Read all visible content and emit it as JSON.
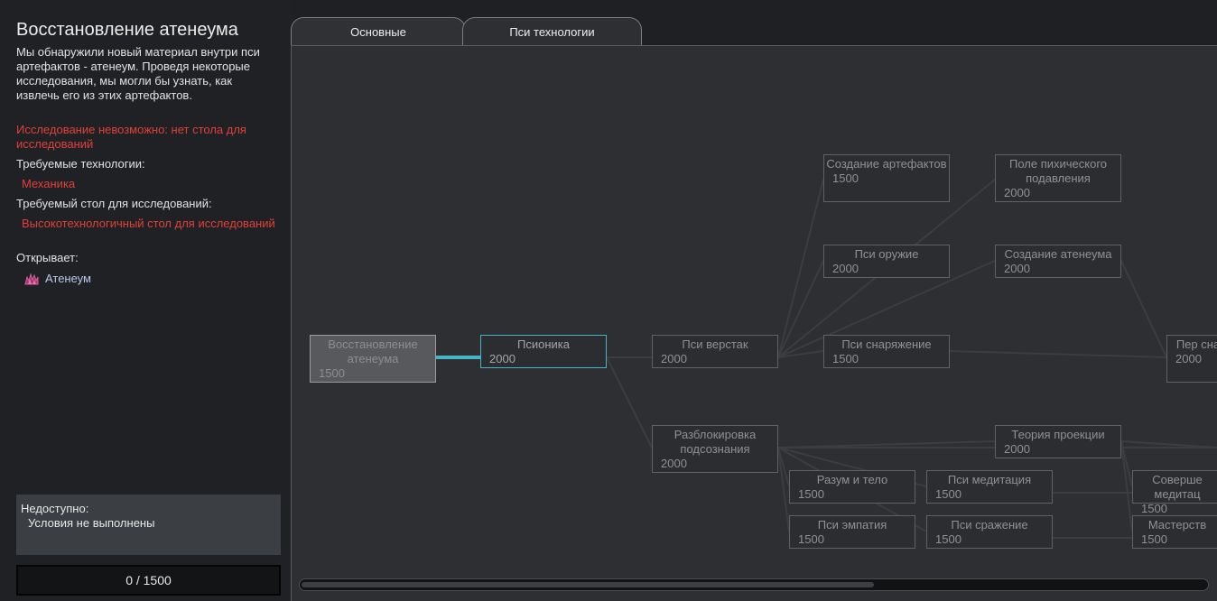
{
  "panel": {
    "title": "Восстановление атенеума",
    "description": "Мы обнаружили новый материал внутри пси артефактов - атенеум. Проведя некоторые исследования, мы могли бы узнать, как извлечь его из этих артефактов.",
    "error": "Исследование невозможно: нет стола для исследований",
    "required_tech_label": "Требуемые технологии:",
    "required_tech": "Механика",
    "required_bench_label": "Требуемый стол для исследований:",
    "required_bench": "Высокотехнологичный стол для исследований",
    "unlocks_label": "Открывает:",
    "unlocks_item": "Атенеум",
    "unlocks_icon": "atheneum-crystal-icon",
    "status_title": "Недоступно:",
    "status_text": "Условия не выполнены",
    "progress": "0 / 1500"
  },
  "tabs": [
    "Основные",
    "Пси технологии"
  ],
  "active_tab": "Пси технологии",
  "colors": {
    "error": "#e0413b",
    "link": "#b9c8ec",
    "prereq_highlight": "#46b4c4",
    "line": "#3b3d40"
  },
  "nodes": [
    {
      "id": "restore",
      "label": "Восстановление атенеума",
      "cost": "1500",
      "state": "current"
    },
    {
      "id": "psionics",
      "label": "Псионика",
      "cost": "2000",
      "state": "prereq"
    },
    {
      "id": "psi-bench",
      "label": "Пси верстак",
      "cost": "2000",
      "state": "locked"
    },
    {
      "id": "subconscious",
      "label": "Разблокировка подсознания",
      "cost": "2000",
      "state": "locked"
    },
    {
      "id": "artifacts",
      "label": "Создание артефактов",
      "cost": "1500",
      "state": "locked"
    },
    {
      "id": "psi-weapon",
      "label": "Пси оружие",
      "cost": "2000",
      "state": "locked"
    },
    {
      "id": "psi-gear",
      "label": "Пси снаряжение",
      "cost": "1500",
      "state": "locked"
    },
    {
      "id": "mind-body",
      "label": "Разум и тело",
      "cost": "1500",
      "state": "locked"
    },
    {
      "id": "psi-empathy",
      "label": "Пси эмпатия",
      "cost": "1500",
      "state": "locked"
    },
    {
      "id": "psi-meditation",
      "label": "Пси медитация",
      "cost": "1500",
      "state": "locked"
    },
    {
      "id": "psi-combat",
      "label": "Пси сражение",
      "cost": "1500",
      "state": "locked"
    },
    {
      "id": "suppression-field",
      "label": "Поле пихического подавления",
      "cost": "2000",
      "state": "locked"
    },
    {
      "id": "atheneum-create",
      "label": "Создание атенеума",
      "cost": "2000",
      "state": "locked"
    },
    {
      "id": "projection",
      "label": "Теория проекции",
      "cost": "2000",
      "state": "locked"
    },
    {
      "id": "perc-cut",
      "label": "Пер сна",
      "cost": "2000",
      "state": "locked"
    },
    {
      "id": "perfect-meditation",
      "label": "Соверше медитац",
      "cost": "1500",
      "state": "locked"
    },
    {
      "id": "mastery",
      "label": "Мастерств",
      "cost": "1500",
      "state": "locked"
    }
  ]
}
